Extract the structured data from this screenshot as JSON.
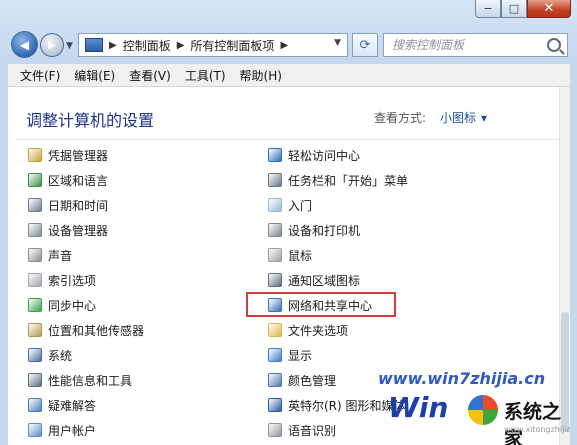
{
  "window": {
    "minimize": "−",
    "maximize": "□",
    "close": "✕"
  },
  "nav": {
    "back_icon": "back-arrow-icon",
    "forward_icon": "forward-arrow-icon",
    "breadcrumbs": [
      "控制面板",
      "所有控制面板项"
    ],
    "search_placeholder": "搜索控制面板"
  },
  "menu": [
    "文件(F)",
    "编辑(E)",
    "查看(V)",
    "工具(T)",
    "帮助(H)"
  ],
  "content": {
    "heading": "调整计算机的设置",
    "view_by_label": "查看方式:",
    "view_by_value": "小图标"
  },
  "left_items": [
    {
      "label": "凭据管理器",
      "color": "#c9a23a"
    },
    {
      "label": "区域和语言",
      "color": "#3a8f47"
    },
    {
      "label": "日期和时间",
      "color": "#6e7d8f"
    },
    {
      "label": "设备管理器",
      "color": "#7d8a96"
    },
    {
      "label": "声音",
      "color": "#8a8f97"
    },
    {
      "label": "索引选项",
      "color": "#a0a6ad"
    },
    {
      "label": "同步中心",
      "color": "#37a44a"
    },
    {
      "label": "位置和其他传感器",
      "color": "#b59a4c"
    },
    {
      "label": "系统",
      "color": "#4a6fa5"
    },
    {
      "label": "性能信息和工具",
      "color": "#5b6d82"
    },
    {
      "label": "疑难解答",
      "color": "#4b7bb8"
    },
    {
      "label": "用户帐户",
      "color": "#5e8cc9"
    }
  ],
  "right_items": [
    {
      "label": "轻松访问中心",
      "color": "#2f6fbd"
    },
    {
      "label": "任务栏和「开始」菜单",
      "color": "#6a7585"
    },
    {
      "label": "入门",
      "color": "#9bb7d9"
    },
    {
      "label": "设备和打印机",
      "color": "#7b8794"
    },
    {
      "label": "鼠标",
      "color": "#9aa0a6"
    },
    {
      "label": "通知区域图标",
      "color": "#5f6d7d"
    },
    {
      "label": "网络和共享中心",
      "color": "#3c72b9"
    },
    {
      "label": "文件夹选项",
      "color": "#e0b54a"
    },
    {
      "label": "显示",
      "color": "#3d7ec2"
    },
    {
      "label": "颜色管理",
      "color": "#4f79a8"
    },
    {
      "label": "英特尔(R) 图形和媒体",
      "color": "#2a58a6"
    },
    {
      "label": "语音识别",
      "color": "#8d96a0"
    }
  ],
  "watermark": {
    "site": "www.win7zhijia.cn",
    "win": "Win",
    "brand": "系统之家",
    "url": "www.xitongzhijia.net"
  }
}
